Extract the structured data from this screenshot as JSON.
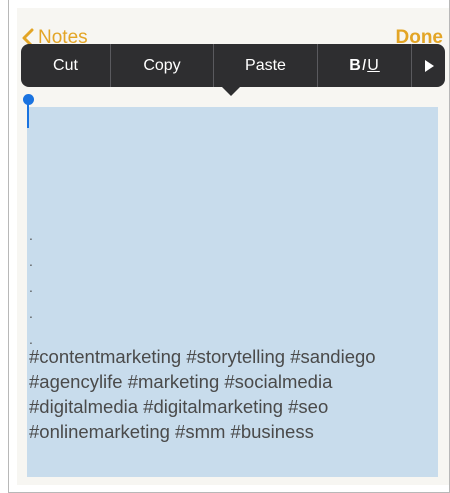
{
  "nav": {
    "back_label": "Notes",
    "done_label": "Done"
  },
  "edit_menu": {
    "cut": "Cut",
    "copy": "Copy",
    "paste": "Paste",
    "format_b": "B",
    "format_i": "I",
    "format_u": "U",
    "more_icon": "play-right-triangle"
  },
  "note": {
    "dots": [
      ".",
      ".",
      ".",
      ".",
      "."
    ],
    "hashtag_lines": [
      "#contentmarketing #storytelling #sandiego",
      "#agencylife #marketing #socialmedia",
      "#digitalmedia #digitalmarketing #seo",
      "#onlinemarketing #smm #business"
    ]
  },
  "colors": {
    "accent": "#e3a526",
    "selection": "#c8dcec",
    "cursor": "#1a73e0",
    "menu_bg": "#2e2e30"
  }
}
